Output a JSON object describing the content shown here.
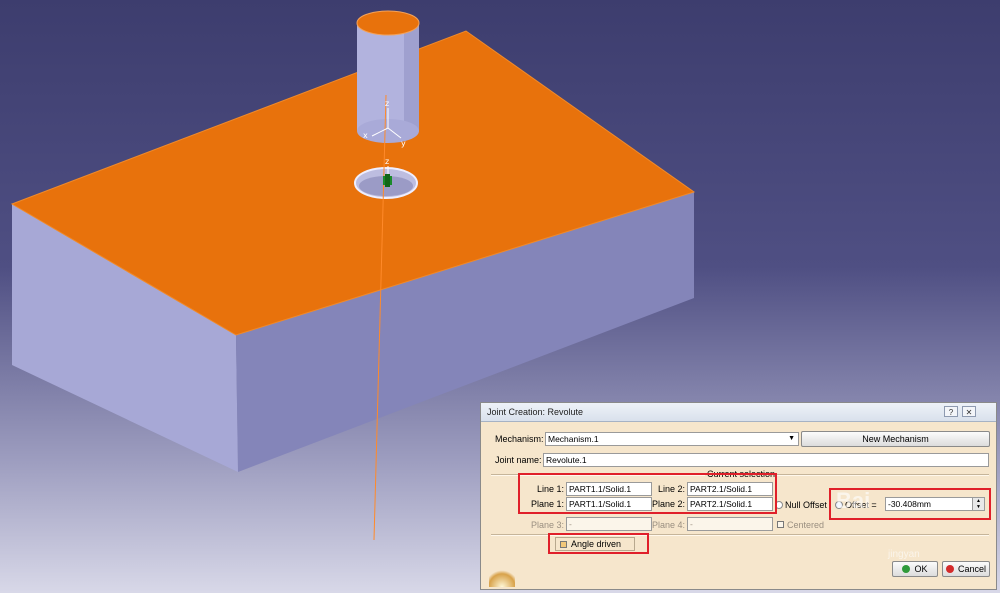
{
  "viewport": {
    "axis_label": "z",
    "compass_axes": [
      "x",
      "y",
      "z"
    ],
    "colors": {
      "background_top": "#3d3d6e",
      "background_bottom": "#d8d8e8",
      "block_top": "#e8720c",
      "block_front": "#a7a8d6",
      "block_side": "#8485b9",
      "cylinder": "#b2b3de",
      "axis_line": "#ff8a2a"
    }
  },
  "dialog": {
    "title": "Joint Creation: Revolute",
    "title_buttons": [
      "?",
      "✕"
    ],
    "mechanism": {
      "label": "Mechanism:",
      "value": "Mechanism.1",
      "button": "New Mechanism"
    },
    "joint_name": {
      "label": "Joint name:",
      "value": "Revolute.1"
    },
    "current_selection_label": "Current selection",
    "line1": {
      "label": "Line 1:",
      "value": "PART1.1/Solid.1"
    },
    "line2": {
      "label": "Line 2:",
      "value": "PART2.1/Solid.1"
    },
    "plane1": {
      "label": "Plane 1:",
      "value": "PART1.1/Solid.1"
    },
    "plane2": {
      "label": "Plane 2:",
      "value": "PART2.1/Solid.1"
    },
    "plane3": {
      "label": "Plane 3:",
      "value": "-"
    },
    "plane4": {
      "label": "Plane 4:",
      "value": "-"
    },
    "null_offset_label": "Null Offset",
    "offset": {
      "label": "Offset =",
      "value": "-30.408mm"
    },
    "centered_label": "Centered",
    "angle_driven": {
      "label": "Angle driven",
      "checked": true
    },
    "ok_label": "OK",
    "cancel_label": "Cancel",
    "icon_colors": {
      "ok": "#2f9a3a",
      "cancel": "#d42a2a"
    }
  },
  "watermark": {
    "logo": "Bai",
    "site": "jingyan"
  }
}
